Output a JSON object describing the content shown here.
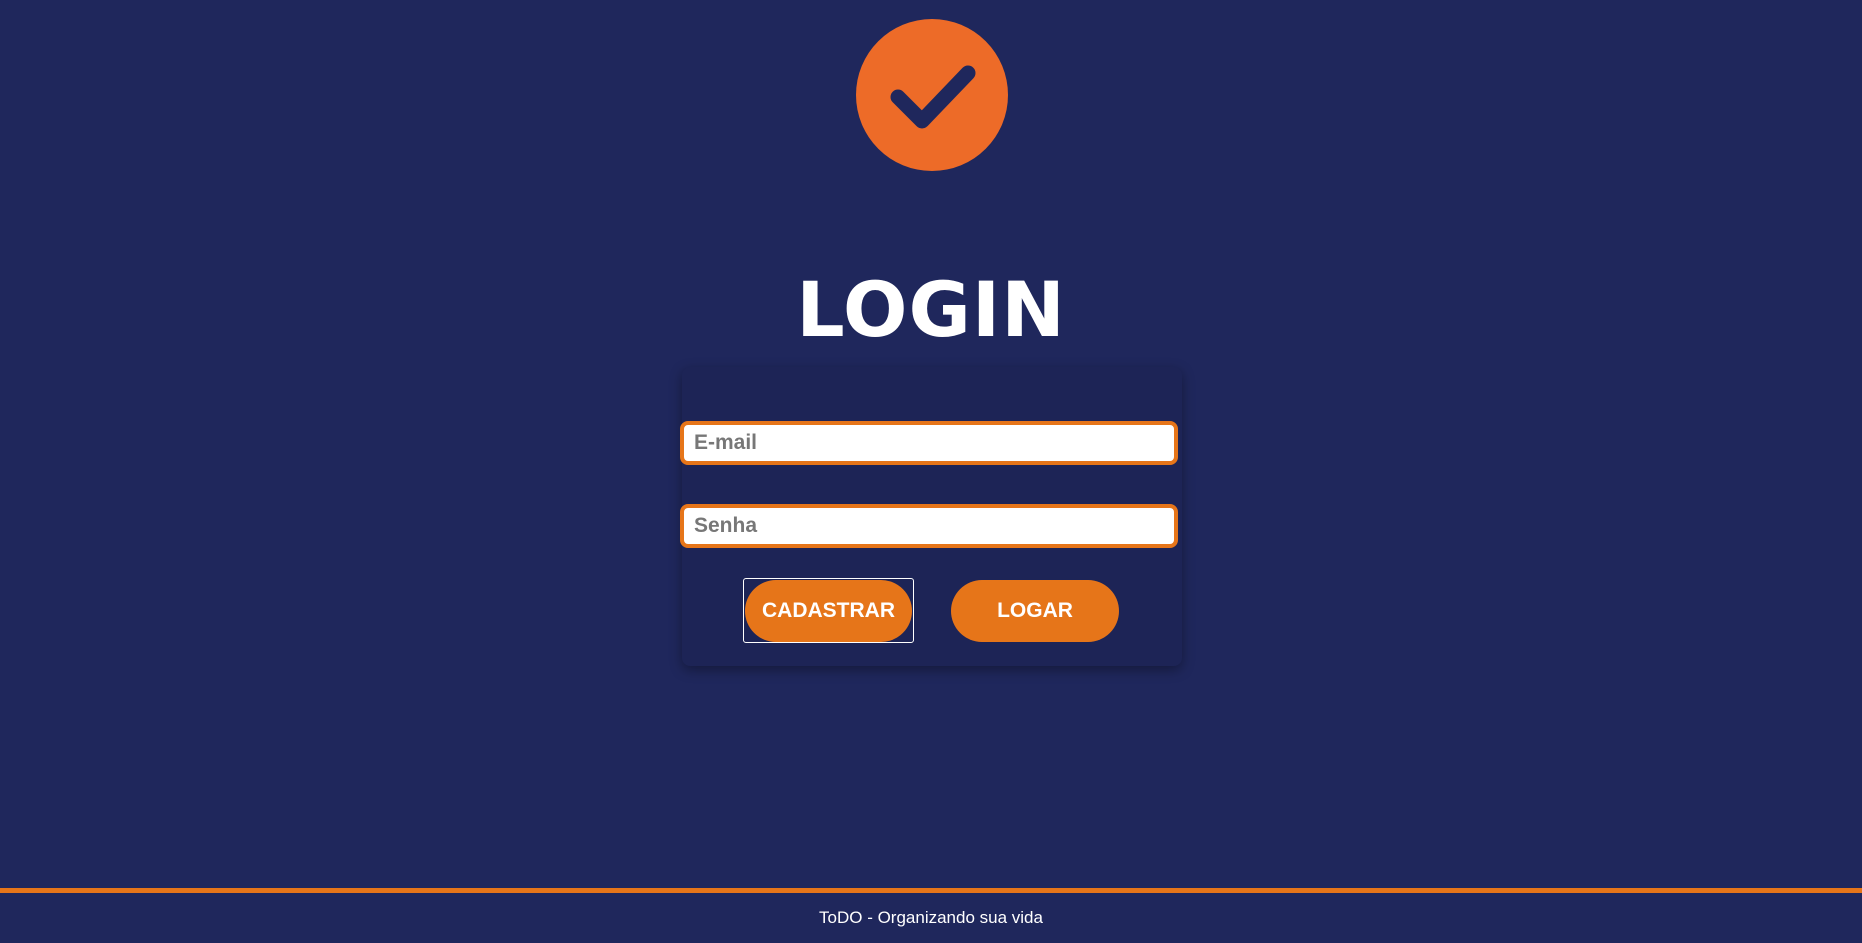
{
  "app": {
    "logo_icon": "checkmark-icon",
    "colors": {
      "background": "#1f275c",
      "accent": "#e67519",
      "logo": "#ed6b28"
    }
  },
  "header": {
    "title": "LOGIN"
  },
  "form": {
    "email": {
      "placeholder": "E-mail",
      "value": ""
    },
    "senha": {
      "placeholder": "Senha",
      "value": ""
    },
    "buttons": {
      "cadastrar": "CADASTRAR",
      "logar": "LOGAR"
    }
  },
  "footer": {
    "text": "ToDO - Organizando sua vida"
  }
}
